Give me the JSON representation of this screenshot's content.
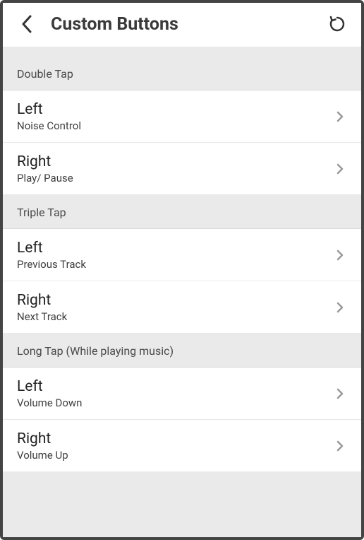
{
  "header": {
    "title": "Custom Buttons"
  },
  "sections": [
    {
      "title": "Double Tap",
      "items": [
        {
          "title": "Left",
          "subtitle": "Noise Control"
        },
        {
          "title": "Right",
          "subtitle": "Play/ Pause"
        }
      ]
    },
    {
      "title": "Triple Tap",
      "items": [
        {
          "title": "Left",
          "subtitle": "Previous Track"
        },
        {
          "title": "Right",
          "subtitle": "Next Track"
        }
      ]
    },
    {
      "title": "Long Tap (While playing music)",
      "items": [
        {
          "title": "Left",
          "subtitle": "Volume Down"
        },
        {
          "title": "Right",
          "subtitle": "Volume Up"
        }
      ]
    }
  ]
}
